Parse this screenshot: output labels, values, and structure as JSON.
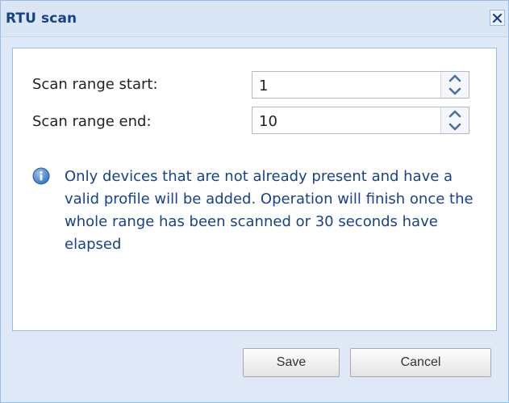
{
  "dialog": {
    "title": "RTU scan",
    "close_icon": "close-icon"
  },
  "form": {
    "scan_start": {
      "label": "Scan range start:",
      "value": "1"
    },
    "scan_end": {
      "label": "Scan range end:",
      "value": "10"
    },
    "spinner_icons": [
      "chevron-up-icon",
      "chevron-down-icon"
    ]
  },
  "info": {
    "icon": "info-icon",
    "text": "Only devices that are not already present and have a valid profile will be added. Operation will finish once the whole range has been scanned or 30 seconds have elapsed"
  },
  "buttons": {
    "save_label": "Save",
    "cancel_label": "Cancel"
  },
  "colors": {
    "title_text": "#15428b",
    "info_text": "#15428b",
    "frame_border": "#99bbe8",
    "frame_bg": "#dfe8f6"
  }
}
